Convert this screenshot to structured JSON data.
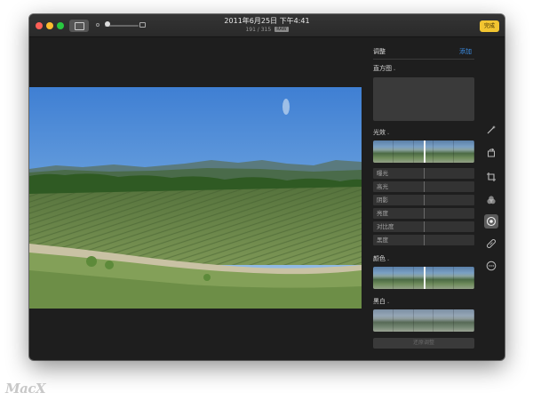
{
  "window": {
    "title": "2011年6月25日 下午4:41",
    "subtitle": "191 / 315",
    "format_badge": "RAW",
    "done_label": "完成",
    "accent_color": "#f2c531"
  },
  "toolbar": {
    "sidebar_icon": "sidebar-icon",
    "zoom_icon": "zoom-slider"
  },
  "panel": {
    "title": "调整",
    "add_label": "添加",
    "add_color": "#3b8fe8",
    "sections": {
      "histogram": {
        "label": "直方图"
      },
      "light": {
        "label": "光效",
        "items": [
          "曝光",
          "高光",
          "阴影",
          "亮度",
          "对比度",
          "黑度"
        ]
      },
      "color": {
        "label": "颜色"
      },
      "bw": {
        "label": "黑白"
      }
    },
    "reset_label": "还原调整"
  },
  "tools": [
    "auto-enhance-icon",
    "rotate-icon",
    "crop-icon",
    "filters-icon",
    "adjust-icon",
    "retouch-icon",
    "more-icon"
  ],
  "watermark": "MacX"
}
